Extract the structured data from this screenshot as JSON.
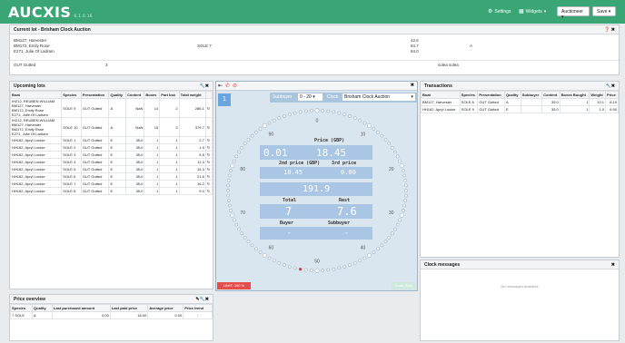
{
  "app": {
    "logo": "AUCXIS",
    "version": "6.1.0.16",
    "settings_label": "Settings",
    "widgets_label": "Widgets",
    "role_value": "Auctioneer",
    "save_label": "Save"
  },
  "current_lot": {
    "title": "Current lot  -  Brisham Clock Auction",
    "sellers": [
      "BM127, Harvester",
      "BM172, Emily Rose",
      "E271, Julie Of Ladram"
    ],
    "species": "SOLE 7",
    "weights": [
      "42.6",
      "84.7",
      "84.0"
    ],
    "grade": "A",
    "presentation": "GUT Gutted",
    "quantity": "3",
    "name": "solea solea"
  },
  "upcoming": {
    "title": "Upcoming lots",
    "columns": [
      "Boat",
      "Species",
      "Presentation",
      "Quality",
      "Content",
      "Boxes",
      "Part box",
      "Total weight",
      ""
    ],
    "rows": [
      {
        "boat": [
          "IH212, REUBEN WILLIAM",
          "BM127, Harvester",
          "BM172, Emily Rose",
          "E271, Julie Of Ladram"
        ],
        "species": "SOLE 9",
        "pres": "GUT Gutted",
        "qual": "A",
        "content": "NaN",
        "boxes": "14",
        "part": "2",
        "total": "286.1"
      },
      {
        "boat": [
          "IH212, REUBEN WILLIAM",
          "BM127, Harvester",
          "BM172, Emily Rose",
          "E271, Julie Of Ladram"
        ],
        "species": "SOLE 10",
        "pres": "GUT Gutted",
        "qual": "A",
        "content": "NaN",
        "boxes": "15",
        "part": "3",
        "total": "379.7"
      },
      {
        "boat": [
          "HH162, Apryl Louise"
        ],
        "species": "SOLE 1",
        "pres": "GUT Gutted",
        "qual": "E",
        "content": "35.0",
        "boxes": "1",
        "part": "1",
        "total": "2.7"
      },
      {
        "boat": [
          "HH162, Apryl Louise"
        ],
        "species": "SOLE 2",
        "pres": "GUT Gutted",
        "qual": "E",
        "content": "35.0",
        "boxes": "1",
        "part": "1",
        "total": "1.9"
      },
      {
        "boat": [
          "HH162, Apryl Louise"
        ],
        "species": "SOLE 3",
        "pres": "GUT Gutted",
        "qual": "E",
        "content": "35.0",
        "boxes": "1",
        "part": "1",
        "total": "5.5"
      },
      {
        "boat": [
          "HH162, Apryl Louise"
        ],
        "species": "SOLE 4",
        "pres": "GUT Gutted",
        "qual": "E",
        "content": "35.0",
        "boxes": "1",
        "part": "1",
        "total": "11.3"
      },
      {
        "boat": [
          "HH162, Apryl Louise"
        ],
        "species": "SOLE 5",
        "pres": "GUT Gutted",
        "qual": "E",
        "content": "35.0",
        "boxes": "1",
        "part": "1",
        "total": "15.3"
      },
      {
        "boat": [
          "HH162, Apryl Louise"
        ],
        "species": "SOLE 6",
        "pres": "GUT Gutted",
        "qual": "E",
        "content": "35.0",
        "boxes": "1",
        "part": "1",
        "total": "21.6"
      },
      {
        "boat": [
          "HH162, Apryl Louise"
        ],
        "species": "SOLE 7",
        "pres": "GUT Gutted",
        "qual": "E",
        "content": "35.0",
        "boxes": "1",
        "part": "1",
        "total": "16.2"
      },
      {
        "boat": [
          "HH162, Apryl Louise"
        ],
        "species": "SOLE 8",
        "pres": "GUT Gutted",
        "qual": "E",
        "content": "35.0",
        "boxes": "1",
        "part": "1",
        "total": "9.0"
      }
    ]
  },
  "clock": {
    "badge": "1",
    "subbuyer_label": "Subbuyer",
    "subbuyer_value": "0 - 20",
    "clock_label": "Clock",
    "clock_value": "Brisham Clock Auction",
    "ticks": [
      "0",
      "10",
      "20",
      "30",
      "40",
      "50",
      "60",
      "70",
      "80",
      "90"
    ],
    "price_label": "Price (GBP)",
    "price_small": "0.01",
    "price_value": "18.45",
    "second_price_label": "2nd price (GBP)",
    "third_price_label": "3rd price",
    "second_price": "18.45",
    "third_price": "0.00",
    "weight_value": "191.9",
    "total_label": "Total",
    "rest_label": "Rest",
    "total_value": "7",
    "rest_value": "7.6",
    "buyer_label": "Buyer",
    "subbuyer2_label": "Subbuyer",
    "buyer_value": "-",
    "subbuyer2_value": "-",
    "limit_label": "LIMIT: 100 %",
    "done_label": "Done [Esc]"
  },
  "transactions": {
    "title": "Transactions",
    "columns": [
      "Boat",
      "Species",
      "Presentation",
      "Quality",
      "Subbuyer",
      "Content",
      "Boxes Bought",
      "Weight",
      "Price"
    ],
    "rows": [
      {
        "boat": "BM127, Harvester",
        "species": "SOLE 6",
        "pres": "GUT Gutted",
        "qual": "A",
        "sub": "",
        "content": "35.0",
        "boxes": "1",
        "weight": "10.1",
        "price": "8.19"
      },
      {
        "boat": "HH162, Apryl Louise",
        "species": "SOLE 9",
        "pres": "GUT Gutted",
        "qual": "E",
        "sub": "",
        "content": "35.0",
        "boxes": "1",
        "weight": "1.0",
        "price": "6.90"
      }
    ]
  },
  "clock_messages": {
    "title": "Clock messages",
    "empty": "No messages available"
  },
  "price_overview": {
    "title": "Price overview",
    "columns": [
      "Species",
      "Quality",
      "Last purchased amount",
      "Last paid price",
      "Average price",
      "Price trend"
    ],
    "rows": [
      {
        "species": "7 SOLE",
        "qual": "A",
        "amount": "0.00",
        "last": "18.00",
        "avg": "0.00",
        "trend": "↑"
      }
    ]
  },
  "colors": {
    "brand": "#3aa676",
    "clock_field": "#a9c6e4",
    "limit": "#e84b4b"
  }
}
